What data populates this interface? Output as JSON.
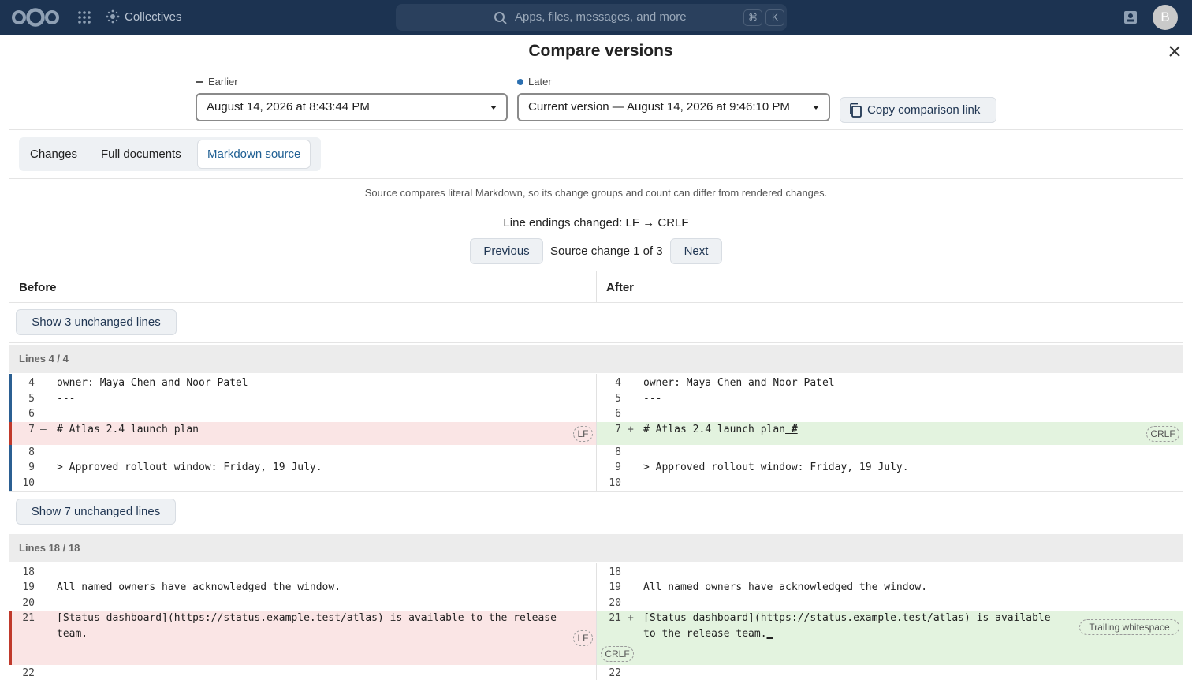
{
  "topbar": {
    "app_name": "Collectives",
    "search_placeholder": "Apps, files, messages, and more",
    "shortcut_key1": "⌘",
    "shortcut_key2": "K",
    "avatar_initial": "B"
  },
  "modal": {
    "title": "Compare versions"
  },
  "versions": {
    "earlier_label": "Earlier",
    "earlier_value": "August 14, 2026 at 8:43:44 PM",
    "later_label": "Later",
    "later_value": "Current version — August 14, 2026 at 9:46:10 PM",
    "copy_link_label": "Copy comparison link"
  },
  "tabs": [
    {
      "label": "Changes"
    },
    {
      "label": "Full documents"
    },
    {
      "label": "Markdown source"
    }
  ],
  "info_text": "Source compares literal Markdown, so its change groups and count can differ from rendered changes.",
  "line_endings_text": "Line endings changed: LF → CRLF",
  "navigation": {
    "previous_label": "Previous",
    "status_text": "Source change 1 of 3",
    "next_label": "Next"
  },
  "diff": {
    "before_label": "Before",
    "after_label": "After",
    "show_unchanged_1": "Show 3 unchanged lines",
    "show_unchanged_2": "Show 7 unchanged lines",
    "hunk1_label": "Lines 4 / 4",
    "hunk2_label": "Lines 18 / 18",
    "hunk1": {
      "l4": "4",
      "l5": "5",
      "l6": "6",
      "l7": "7",
      "l8": "8",
      "l9": "9",
      "l10": "10",
      "owner": "owner: Maya Chen and Noor Patel",
      "fm": "---",
      "title_before": "# Atlas 2.4 launch plan",
      "title_after": "# Atlas 2.4 launch plan",
      "title_after_marker": " #",
      "quote": "> Approved rollout window: Friday, 19 July.",
      "del_sign": "–",
      "add_sign": "+",
      "badge_lf": "LF",
      "badge_crlf": "CRLF"
    },
    "hunk2": {
      "l18": "18",
      "l19": "19",
      "l20": "20",
      "l21": "21",
      "l22": "22",
      "ack": "All named owners have acknowledged the window.",
      "status_before_1": "[Status dashboard](https://status.example.test/atlas) is available to the release",
      "status_before_2": "team.",
      "status_after_1": "[Status dashboard](https://status.example.test/atlas) is available",
      "status_after_2": "to the release team.",
      "status_after_marker": "_",
      "badge_lf": "LF",
      "badge_crlf": "CRLF",
      "badge_whitespace": "Trailing whitespace"
    }
  }
}
